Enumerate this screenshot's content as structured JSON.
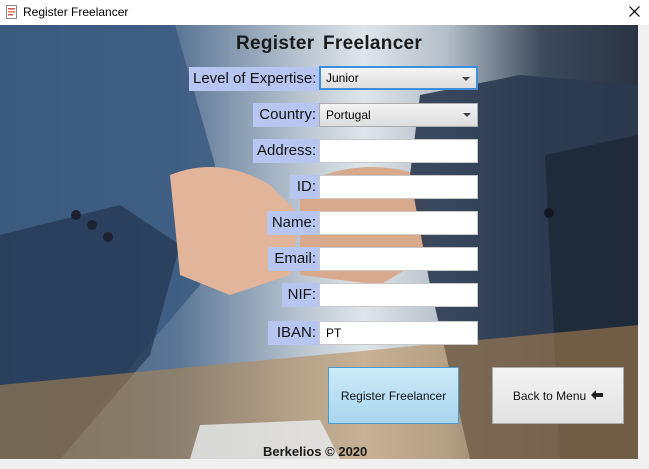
{
  "window": {
    "title": "Register Freelancer",
    "close_glyph": "✕"
  },
  "form": {
    "heading": "Register  Freelancer",
    "fields": {
      "expertise": {
        "label": "Level of Expertise:",
        "value": "Junior"
      },
      "country": {
        "label": "Country:",
        "value": "Portugal"
      },
      "address": {
        "label": "Address:",
        "value": ""
      },
      "id": {
        "label": "ID:",
        "value": ""
      },
      "name": {
        "label": "Name:",
        "value": ""
      },
      "email": {
        "label": "Email:",
        "value": ""
      },
      "nif": {
        "label": "NIF:",
        "value": ""
      },
      "iban": {
        "label": "IBAN:",
        "value": "PT"
      }
    }
  },
  "buttons": {
    "register": "Register Freelancer",
    "back": "Back to Menu",
    "back_arrow": "🠔"
  },
  "footer": "Berkelios © 2020",
  "colors": {
    "label_bg": "#b6c6f0",
    "focus_border": "#3d8ee0",
    "register_button": "#a9d6ee"
  },
  "icons": {
    "app": "document-icon",
    "close": "close-icon",
    "back": "left-arrow-icon"
  }
}
